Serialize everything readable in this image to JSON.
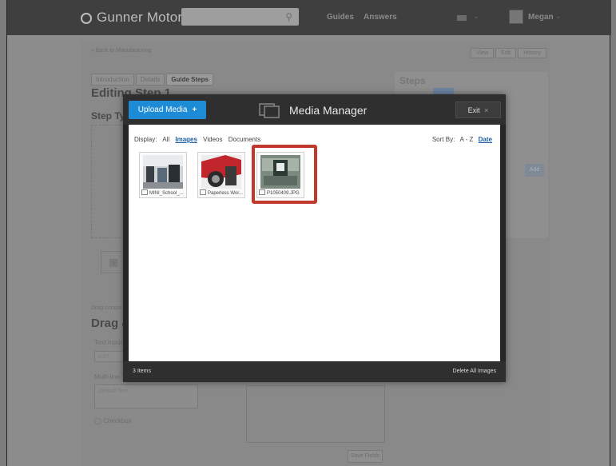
{
  "topbar": {
    "logo": "Gunner Motors",
    "nav": [
      "Guides",
      "Answers"
    ],
    "user": "Megan"
  },
  "page": {
    "back_link": "« Back to Manufacturing",
    "view_tabs": [
      "View",
      "Edit",
      "History"
    ],
    "guide_tabs": [
      "Introduction",
      "Details",
      "Guide Steps"
    ],
    "editing_title": "Editing Step 1",
    "step_type": "Step Ty",
    "drag_components": "Drag compo",
    "drag_heading": "Drag &",
    "text_input_label": "Text Input",
    "text_input_value": "0.07",
    "multiline_label": "Multi-line T",
    "multiline_value": "Default Text",
    "checkbox_label": "Checkbox",
    "save_label": "Save Fields",
    "steps_heading": "Steps",
    "add_label": "Add"
  },
  "modal": {
    "upload_label": "Upload Media",
    "upload_icon": "+",
    "title": "Media Manager",
    "exit_label": "Exit",
    "exit_icon": "×",
    "display_label": "Display:",
    "filters": [
      "All",
      "Images",
      "Videos",
      "Documents"
    ],
    "active_filter": "Images",
    "sort_label": "Sort By:",
    "sort_options": [
      "A - Z",
      "Date"
    ],
    "active_sort": "Date",
    "items": [
      {
        "name": "MINI_School_..."
      },
      {
        "name": "Paperless Wor..."
      },
      {
        "name": "P1050409.JPG"
      }
    ],
    "highlighted_item": "P1050409.JPG",
    "item_count": "3 Items",
    "delete_all_label": "Delete All Images"
  },
  "colors": {
    "upload_button": "#1d8bd6",
    "highlight": "#c0392b",
    "modal_bg": "#262626"
  }
}
